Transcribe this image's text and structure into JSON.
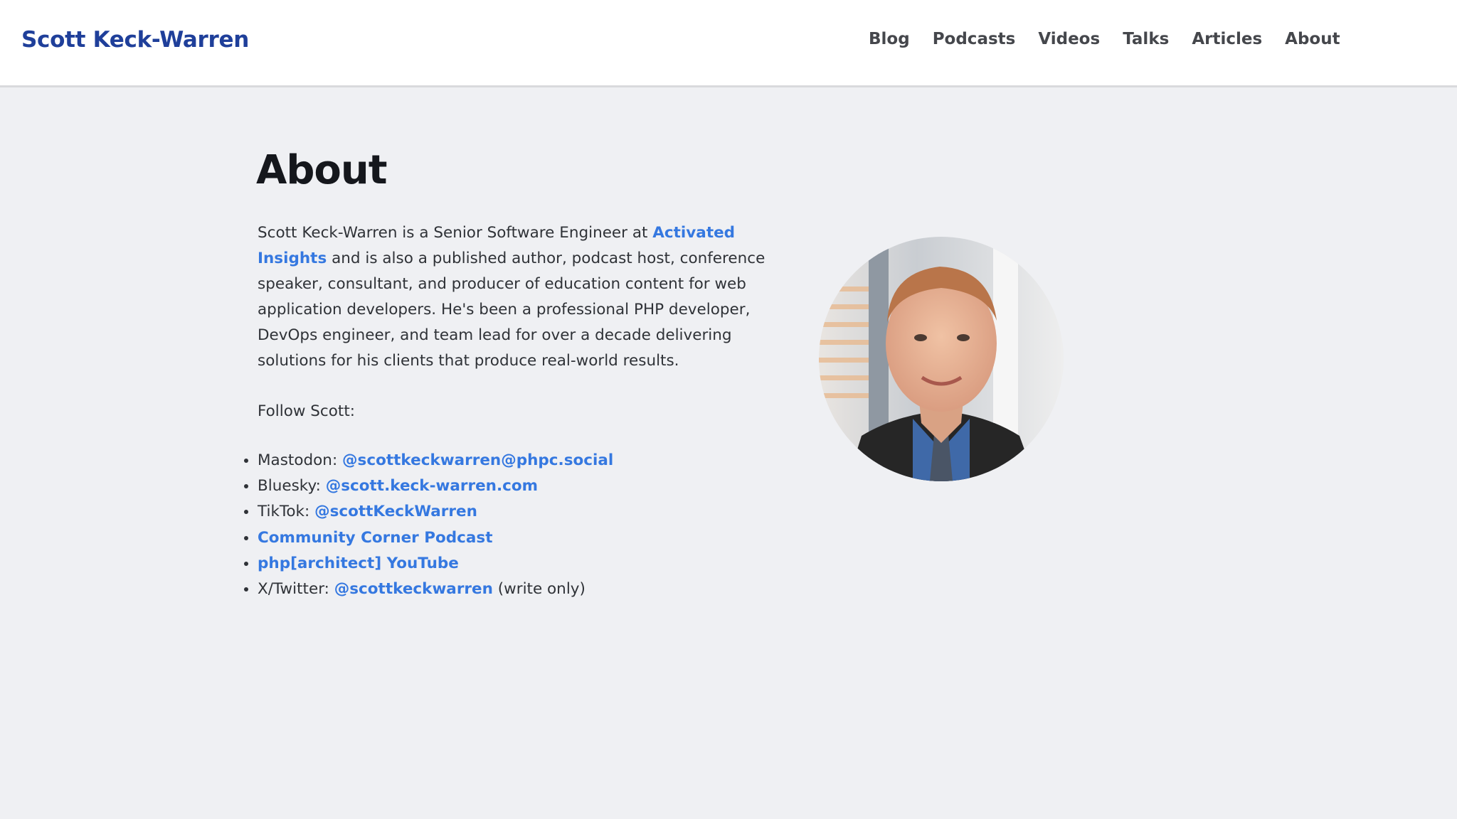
{
  "header": {
    "site_title": "Scott Keck-Warren",
    "nav": [
      {
        "label": "Blog"
      },
      {
        "label": "Podcasts"
      },
      {
        "label": "Videos"
      },
      {
        "label": "Talks"
      },
      {
        "label": "Articles"
      },
      {
        "label": "About"
      }
    ]
  },
  "main": {
    "title": "About",
    "bio": {
      "before_link": "Scott Keck-Warren is a Senior Software Engineer at ",
      "link_text": "Activated Insights",
      "after_link": " and is also a published author, podcast host, conference speaker, consultant, and producer of education content for web application developers. He's been a professional PHP developer, DevOps engineer, and team lead for over a decade delivering solutions for his clients that produce real-world results."
    },
    "follow_label": "Follow Scott:",
    "social": [
      {
        "prefix": "Mastodon: ",
        "link": "@scottkeckwarren@phpc.social",
        "suffix": ""
      },
      {
        "prefix": "Bluesky: ",
        "link": "@scott.keck-warren.com",
        "suffix": ""
      },
      {
        "prefix": "TikTok: ",
        "link": "@scottKeckWarren",
        "suffix": ""
      },
      {
        "prefix": "",
        "link": "Community Corner Podcast",
        "suffix": ""
      },
      {
        "prefix": "",
        "link": "php[architect] YouTube",
        "suffix": ""
      },
      {
        "prefix": "X/Twitter: ",
        "link": "@scottkeckwarren",
        "suffix": " (write only)"
      }
    ],
    "portrait_icon": "portrait-photo"
  },
  "colors": {
    "brand": "#1f3f9a",
    "link": "#3578e0",
    "background": "#eff0f3"
  }
}
